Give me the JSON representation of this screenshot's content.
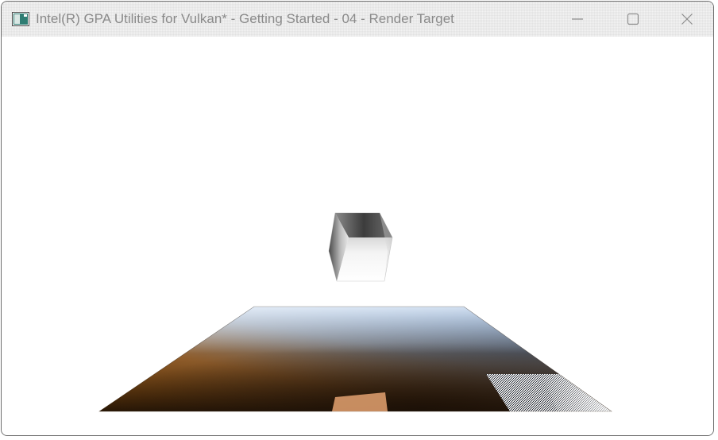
{
  "window": {
    "title": "Intel(R) GPA Utilities for Vulkan* - Getting Started - 04 - Render Target",
    "app_icon": "app-window-icon",
    "controls": {
      "minimize": "minimize-icon",
      "maximize": "maximize-icon",
      "close": "close-icon"
    }
  },
  "scene": {
    "objects": [
      "floating-cube",
      "gradient-floor-plane",
      "floor-highlight-quad"
    ],
    "colors": {
      "floor_orange": "#ff8a00",
      "floor_blue": "#0a6fe8",
      "floor_dark": "#1a1008",
      "cube_light": "#ffffff",
      "cube_dark": "#555555"
    }
  }
}
